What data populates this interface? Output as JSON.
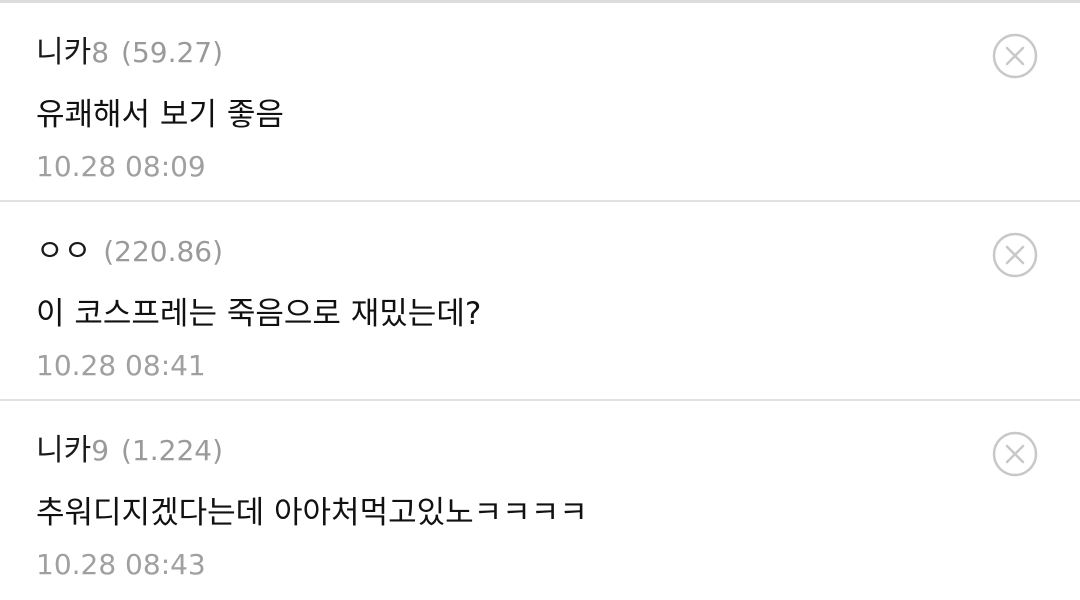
{
  "comments": [
    {
      "author": "니카",
      "author_suffix": "8",
      "ip": "(59.27)",
      "text": "유쾌해서 보기 좋음",
      "time": "10.28 08:09",
      "delete_icon": "close-circle-icon"
    },
    {
      "author": "ㅇㅇ",
      "author_suffix": "",
      "ip": "(220.86)",
      "text": "이 코스프레는 죽음으로 재밌는데?",
      "time": "10.28 08:41",
      "delete_icon": "close-circle-icon"
    },
    {
      "author": "니카",
      "author_suffix": "9",
      "ip": "(1.224)",
      "text": "추워디지겠다는데 아아처먹고있노ㅋㅋㅋㅋ",
      "time": "10.28 08:43",
      "delete_icon": "close-circle-icon"
    }
  ],
  "colors": {
    "author": "#1a1a1a",
    "meta": "#9a9a9a",
    "text": "#111111",
    "divider": "#e1e1e1",
    "icon": "#c8c8c8"
  }
}
